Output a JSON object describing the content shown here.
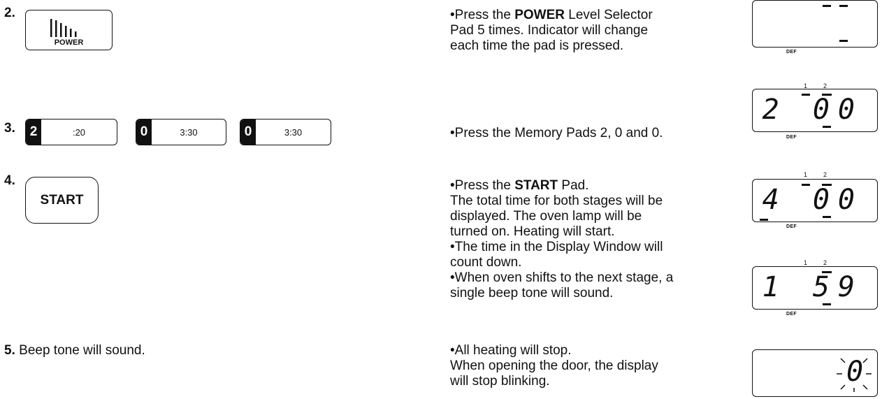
{
  "steps": [
    {
      "number": "2.",
      "pad_label": "POWER",
      "desc_bold": "POWER",
      "desc_pre": "•Press the ",
      "desc_post": " Level Selector",
      "desc_lines": [
        "Pad 5 times. Indicator will change",
        "each time the pad is pressed."
      ],
      "display": {
        "digits": "",
        "label": "DEF",
        "indices": ""
      }
    },
    {
      "number": "3.",
      "memory_pads": [
        {
          "key": "2",
          "time": ":20"
        },
        {
          "key": "0",
          "time": "3:30"
        },
        {
          "key": "0",
          "time": "3:30"
        }
      ],
      "desc": "•Press the Memory Pads 2, 0 and 0.",
      "display": {
        "digits": "2 00",
        "label": "DEF",
        "idx1": "1",
        "idx2": "2"
      }
    },
    {
      "number": "4.",
      "pad_label": "START",
      "desc_pre": "•Press the ",
      "desc_bold": "START",
      "desc_post": " Pad.",
      "desc_lines": [
        "The total time for both stages will be",
        "displayed. The oven lamp will be",
        "turned on. Heating will start.",
        "•The time in the Display Window will",
        "count down.",
        "•When oven shifts to the next stage, a",
        "single beep tone will sound."
      ],
      "display": {
        "digits": "4 00",
        "label": "DEF",
        "idx1": "1",
        "idx2": "2"
      },
      "display2": {
        "digits": "1 59",
        "label": "DEF",
        "idx1": "1",
        "idx2": "2"
      }
    },
    {
      "number": "5.",
      "text": "Beep tone will sound.",
      "desc_lines": [
        "•All heating will stop.",
        "When opening the door, the display",
        "will stop blinking."
      ],
      "display": {
        "digits": "0"
      }
    }
  ]
}
